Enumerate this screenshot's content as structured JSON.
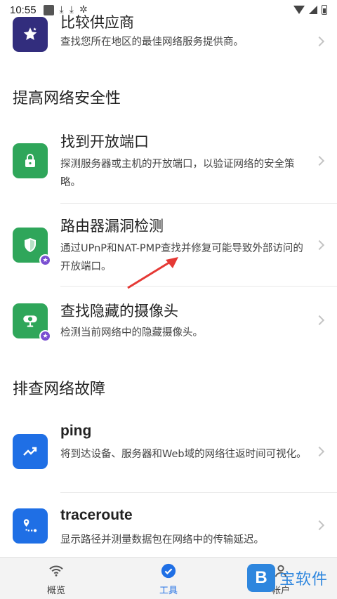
{
  "status": {
    "time": "10:55"
  },
  "sections": {
    "security": "提高网络安全性",
    "troubleshoot": "排查网络故障"
  },
  "items": {
    "compare": {
      "title": "比较供应商",
      "desc": "查找您所在地区的最佳网络服务提供商。",
      "icon": "star-icon"
    },
    "open_ports": {
      "title": "找到开放端口",
      "desc": "探测服务器或主机的开放端口，以验证网络的安全策略。",
      "icon": "lock-icon"
    },
    "router_vuln": {
      "title": "路由器漏洞检测",
      "desc": "通过UPnP和NAT-PMP查找并修复可能导致外部访问的开放端口。",
      "icon": "shield-icon",
      "badge": "★"
    },
    "hidden_cam": {
      "title": "查找隐藏的摄像头",
      "desc": "检测当前网络中的隐藏摄像头。",
      "icon": "camera-icon",
      "badge": "★"
    },
    "ping": {
      "title": "ping",
      "desc": "将到达设备、服务器和Web域的网络往返时间可视化。",
      "icon": "trend-icon"
    },
    "traceroute": {
      "title": "traceroute",
      "desc": "显示路径并测量数据包在网络中的传输延迟。",
      "icon": "route-icon"
    }
  },
  "tabs": {
    "overview": "概览",
    "tools": "工具",
    "account": "帐户"
  },
  "watermark": {
    "letter": "B",
    "text": "宝软件"
  },
  "colors": {
    "green": "#2fa65a",
    "blue": "#1f6fe5",
    "purple": "#322d7d",
    "badge": "#7a4fd1"
  }
}
